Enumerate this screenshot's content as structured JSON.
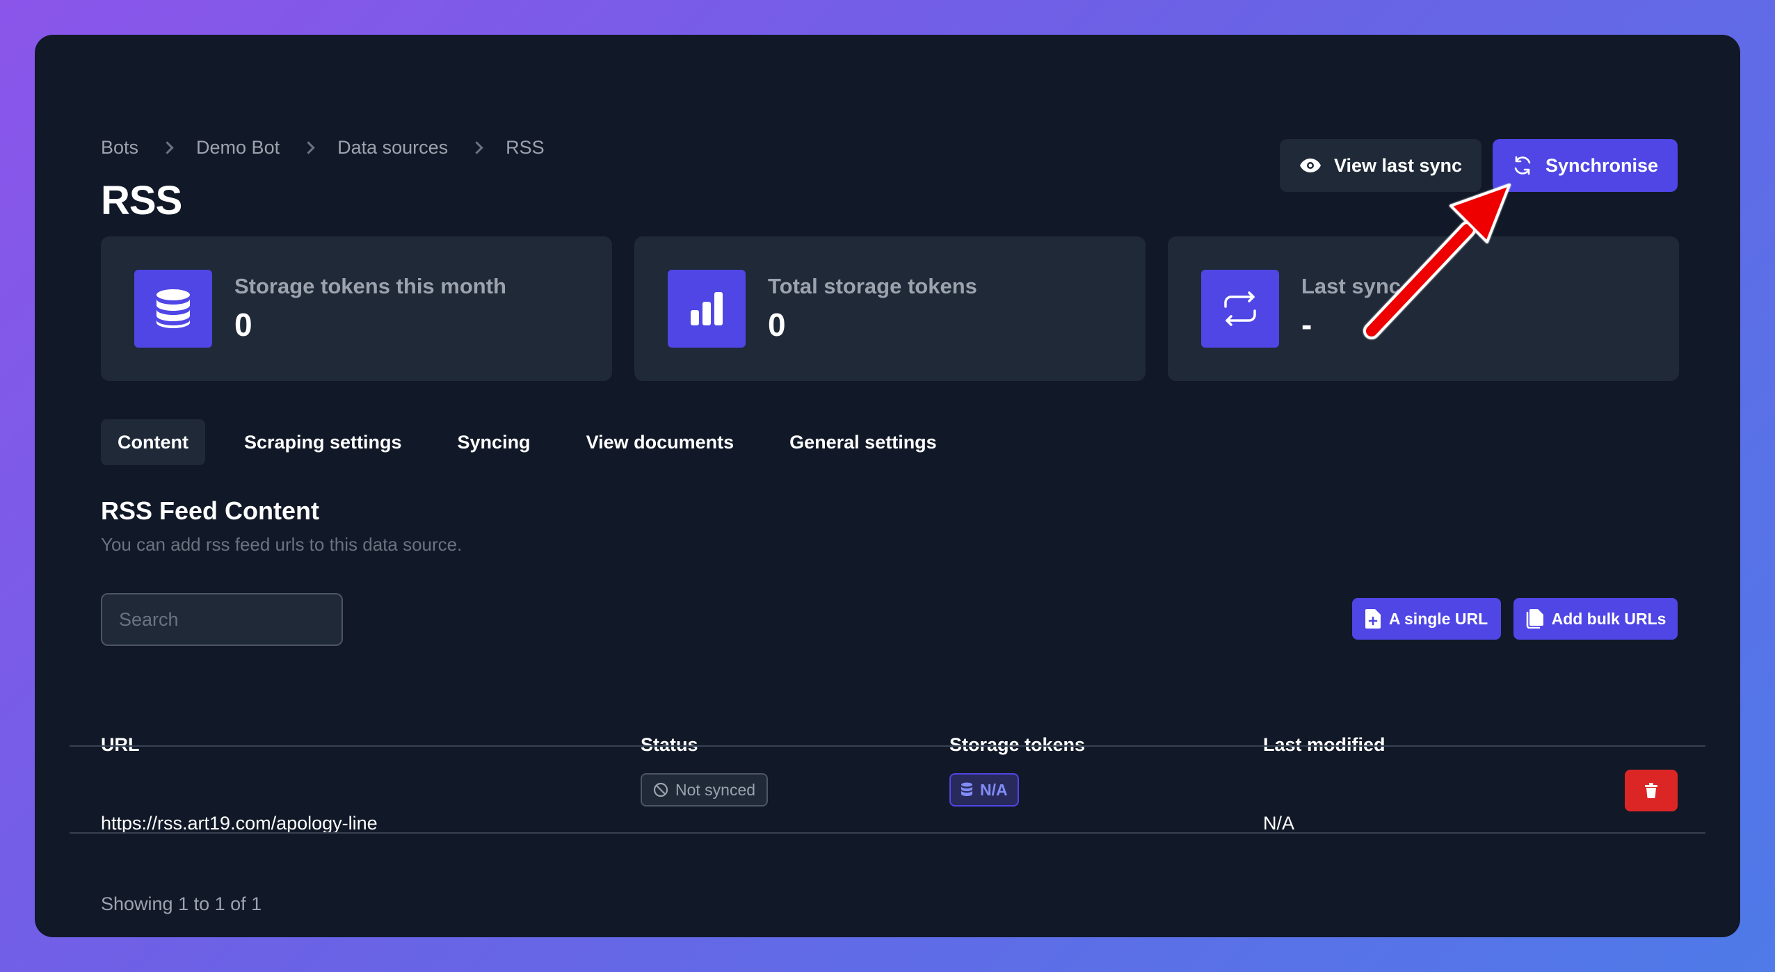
{
  "breadcrumb": [
    "Bots",
    "Demo Bot",
    "Data sources",
    "RSS"
  ],
  "page": {
    "title": "RSS"
  },
  "header_buttons": {
    "view_last_sync": "View last sync",
    "synchronise": "Synchronise"
  },
  "stats": [
    {
      "label": "Storage tokens this month",
      "value": "0",
      "icon": "database-icon"
    },
    {
      "label": "Total storage tokens",
      "value": "0",
      "icon": "bar-chart-icon"
    },
    {
      "label": "Last sync",
      "value": "-",
      "icon": "sync-icon"
    }
  ],
  "tabs": [
    "Content",
    "Scraping settings",
    "Syncing",
    "View documents",
    "General settings"
  ],
  "active_tab": "Content",
  "section": {
    "title": "RSS Feed Content",
    "description": "You can add rss feed urls to this data source."
  },
  "search": {
    "placeholder": "Search",
    "value": ""
  },
  "action_buttons": {
    "single_url": "A single URL",
    "bulk_urls": "Add bulk URLs"
  },
  "table": {
    "columns": [
      "URL",
      "Status",
      "Storage tokens",
      "Last modified"
    ],
    "rows": [
      {
        "url": "https://rss.art19.com/apology-line",
        "status": "Not synced",
        "storage_tokens": "N/A",
        "last_modified": "N/A"
      }
    ]
  },
  "footer": {
    "showing": "Showing 1 to 1 of 1"
  },
  "colors": {
    "accent": "#4f46e5",
    "background": "#111827",
    "card": "#1f2937",
    "danger": "#dc2626",
    "annotation_arrow": "#ff0000"
  }
}
